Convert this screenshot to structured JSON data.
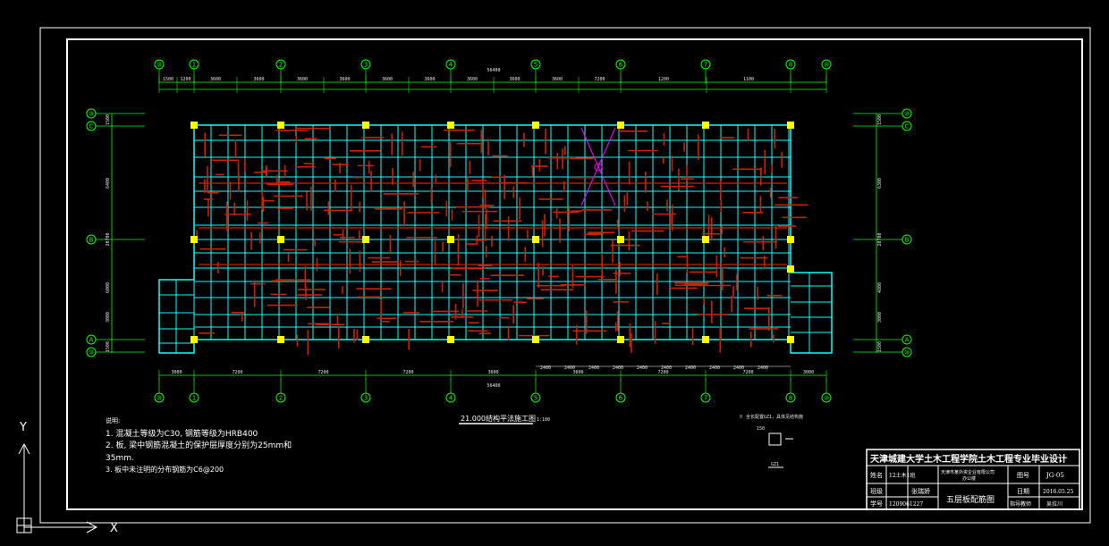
{
  "drawing": {
    "plan_title": "21.000结构平法施工图",
    "plan_scale": "1:100",
    "overall_width": "56400",
    "bottom_overall_width": "56400",
    "axes_x": [
      "⑩",
      "1",
      "2",
      "3",
      "4",
      "5",
      "6",
      "7",
      "8",
      "⑩"
    ],
    "axes_y_left": [
      "⑩",
      "C",
      "B",
      "A",
      "⑩"
    ],
    "axes_y_right": [
      "⑩",
      "C",
      "B",
      "A",
      "⑩"
    ],
    "top_dims": [
      "1500",
      "1200",
      "3600",
      "3600",
      "3600",
      "3600",
      "3600",
      "3600",
      "3600",
      "3600",
      "3600",
      "7200",
      "1200",
      "1100"
    ],
    "bottom_dims": [
      "3000",
      "7200",
      "7200",
      "7200",
      "7200",
      "3000"
    ],
    "bottom_dims_row2": [
      "2400",
      "2400",
      "2400",
      "2400",
      "2400",
      "2400",
      "2400",
      "2400",
      "2400",
      "2400"
    ],
    "bottom_dims_row3": [
      "3600",
      "7200",
      "7200"
    ],
    "left_dims": [
      "1500",
      "6400",
      "20700",
      "6000",
      "3000",
      "1500"
    ],
    "right_dims": [
      "1500",
      "6300",
      "20700",
      "4800",
      "3000",
      "1500"
    ],
    "detail_note": "※ 全长配置GZ1，具体见结构施",
    "detail_label": "GZ1",
    "detail_dim": "150"
  },
  "notes": {
    "heading": "说明:",
    "line1": "1. 混凝土等级为C30, 钢筋等级为HRB400",
    "line2": "2. 板, 梁中钢筋混凝土的保护层厚度分别为25mm和",
    "line3": "35mm.",
    "line4": "3. 板中未注明的分布钢筋为C6@200"
  },
  "title_block": {
    "school": "天津城建大学土木工程学院土木工程专业毕业设计",
    "name_label": "姓名",
    "class_value": "12土木1班",
    "project_value": "天津市某外资企业有限公司",
    "project_value2": "办公楼",
    "drawing_no_label": "图号",
    "drawing_no_value": "JG-05",
    "student_label": "班级",
    "student_value": "张瑞娇",
    "id_label": "学号",
    "id_value": "1209061227",
    "drawing_name": "五层板配筋图",
    "date_label": "日期",
    "date_value": "2016.05.25",
    "advisor_label": "指导教师",
    "advisor_value": "吴拉川"
  },
  "ucs": {
    "y_label": "Y",
    "x_label": "X"
  },
  "colors": {
    "grid": "#00ffff",
    "rebar": "#cc2200",
    "axis": "#00ff00",
    "column": "#ffff00",
    "frame": "#ffffff",
    "brace": "#ff00ff"
  }
}
